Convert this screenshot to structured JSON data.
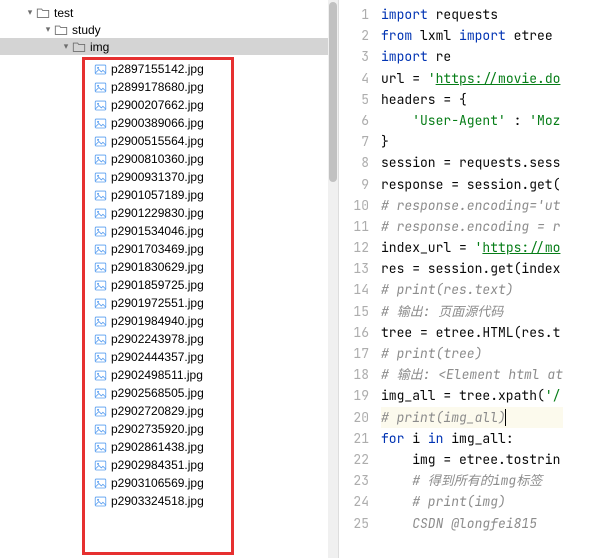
{
  "tree": {
    "root": "test",
    "child1": "study",
    "child2": "img"
  },
  "files": [
    "p2897155142.jpg",
    "p2899178680.jpg",
    "p2900207662.jpg",
    "p2900389066.jpg",
    "p2900515564.jpg",
    "p2900810360.jpg",
    "p2900931370.jpg",
    "p2901057189.jpg",
    "p2901229830.jpg",
    "p2901534046.jpg",
    "p2901703469.jpg",
    "p2901830629.jpg",
    "p2901859725.jpg",
    "p2901972551.jpg",
    "p2901984940.jpg",
    "p2902243978.jpg",
    "p2902444357.jpg",
    "p2902498511.jpg",
    "p2902568505.jpg",
    "p2902720829.jpg",
    "p2902735920.jpg",
    "p2902861438.jpg",
    "p2902984351.jpg",
    "p2903106569.jpg",
    "p2903324518.jpg"
  ],
  "code": {
    "lines": [
      {
        "n": 1,
        "seg": [
          {
            "t": "import ",
            "c": "kw"
          },
          {
            "t": "requests",
            "c": "id"
          }
        ]
      },
      {
        "n": 2,
        "seg": [
          {
            "t": "from ",
            "c": "kw"
          },
          {
            "t": "lxml ",
            "c": "id"
          },
          {
            "t": "import ",
            "c": "kw"
          },
          {
            "t": "etree",
            "c": "id"
          }
        ]
      },
      {
        "n": 3,
        "seg": [
          {
            "t": "import ",
            "c": "kw"
          },
          {
            "t": "re",
            "c": "id"
          }
        ]
      },
      {
        "n": 4,
        "seg": [
          {
            "t": "url = ",
            "c": "id"
          },
          {
            "t": "'",
            "c": "str"
          },
          {
            "t": "https://movie.do",
            "c": "str-u"
          }
        ]
      },
      {
        "n": 5,
        "seg": [
          {
            "t": "headers = {",
            "c": "id"
          }
        ]
      },
      {
        "n": 6,
        "seg": [
          {
            "t": "    ",
            "c": "id"
          },
          {
            "t": "'User-Agent'",
            "c": "str"
          },
          {
            "t": " : ",
            "c": "id"
          },
          {
            "t": "'Moz",
            "c": "str"
          }
        ]
      },
      {
        "n": 7,
        "seg": [
          {
            "t": "}",
            "c": "id"
          }
        ]
      },
      {
        "n": 8,
        "seg": [
          {
            "t": "session = requests.sess",
            "c": "id"
          }
        ]
      },
      {
        "n": 9,
        "seg": [
          {
            "t": "response = session.get(",
            "c": "id"
          }
        ]
      },
      {
        "n": 10,
        "seg": [
          {
            "t": "# response.encoding='ut",
            "c": "com"
          }
        ]
      },
      {
        "n": 11,
        "seg": [
          {
            "t": "# response.encoding = r",
            "c": "com"
          }
        ]
      },
      {
        "n": 12,
        "seg": [
          {
            "t": "index_url = ",
            "c": "id"
          },
          {
            "t": "'",
            "c": "str"
          },
          {
            "t": "https://mo",
            "c": "str-u"
          }
        ]
      },
      {
        "n": 13,
        "seg": [
          {
            "t": "res = session.get(index",
            "c": "id"
          }
        ]
      },
      {
        "n": 14,
        "seg": [
          {
            "t": "# print(res.text)",
            "c": "com"
          }
        ]
      },
      {
        "n": 15,
        "seg": [
          {
            "t": "# 输出: 页面源代码",
            "c": "com"
          }
        ]
      },
      {
        "n": 16,
        "seg": [
          {
            "t": "tree = etree.HTML(res.t",
            "c": "id"
          }
        ]
      },
      {
        "n": 17,
        "seg": [
          {
            "t": "# print(tree)",
            "c": "com"
          }
        ]
      },
      {
        "n": 18,
        "seg": [
          {
            "t": "# 输出: <Element html at",
            "c": "com"
          }
        ]
      },
      {
        "n": 19,
        "seg": [
          {
            "t": "img_all = tree.xpath(",
            "c": "id"
          },
          {
            "t": "'/",
            "c": "str"
          }
        ]
      },
      {
        "n": 20,
        "seg": [
          {
            "t": "# print(img_all)",
            "c": "com"
          }
        ],
        "hl": true,
        "caret": true
      },
      {
        "n": 21,
        "seg": [
          {
            "t": "for ",
            "c": "kw"
          },
          {
            "t": "i ",
            "c": "id"
          },
          {
            "t": "in ",
            "c": "kw"
          },
          {
            "t": "img_all:",
            "c": "id"
          }
        ]
      },
      {
        "n": 22,
        "seg": [
          {
            "t": "    img = etree.tostrin",
            "c": "id"
          }
        ]
      },
      {
        "n": 23,
        "seg": [
          {
            "t": "    ",
            "c": "id"
          },
          {
            "t": "# 得到所有的img标签",
            "c": "com"
          }
        ]
      },
      {
        "n": 24,
        "seg": [
          {
            "t": "    ",
            "c": "id"
          },
          {
            "t": "# print(img)",
            "c": "com"
          }
        ]
      },
      {
        "n": 25,
        "seg": [
          {
            "t": "    CSDN @longfei815",
            "c": "com"
          }
        ]
      }
    ]
  }
}
